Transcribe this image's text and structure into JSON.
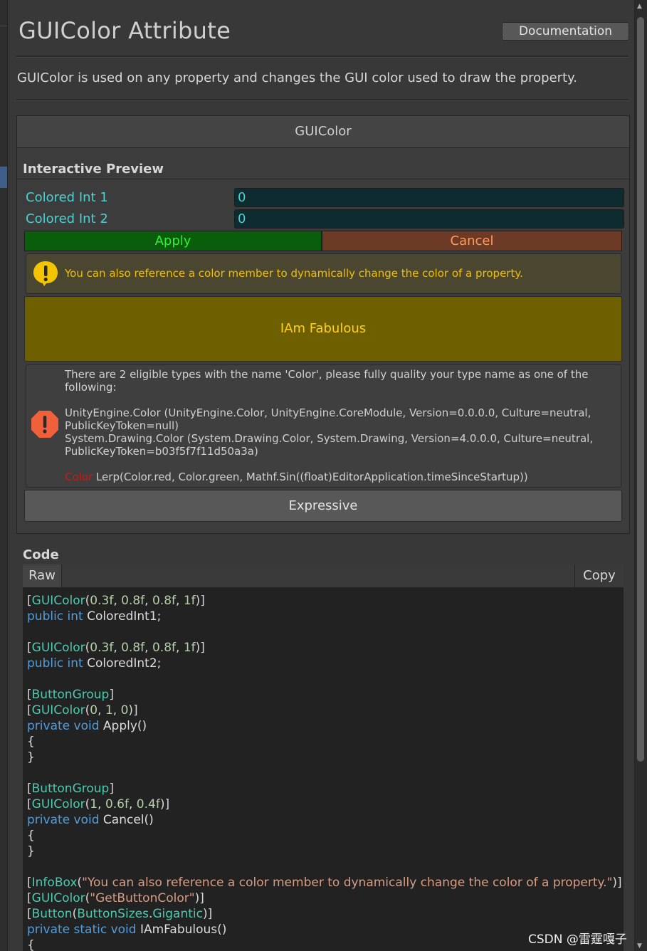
{
  "header": {
    "title": "GUIColor Attribute",
    "documentation_button": "Documentation",
    "description": "GUIColor is used on any property and changes the GUI color used to draw the property."
  },
  "panel": {
    "title": "GUIColor",
    "section_label": "Interactive Preview",
    "fields": [
      {
        "label": "Colored Int 1",
        "value": "0"
      },
      {
        "label": "Colored Int 2",
        "value": "0"
      }
    ],
    "apply_label": "Apply",
    "cancel_label": "Cancel",
    "info_text": "You can also reference a color member to dynamically change the color of a property.",
    "fabulous_label": "IAm Fabulous",
    "error": {
      "line1": "There are 2 eligible types with the name 'Color', please fully quality your type name as one of the following:",
      "line2": "UnityEngine.Color (UnityEngine.Color, UnityEngine.CoreModule, Version=0.0.0.0, Culture=neutral, PublicKeyToken=null)",
      "line3": "System.Drawing.Color (System.Drawing.Color, System.Drawing, Version=4.0.0.0, Culture=neutral, PublicKeyToken=b03f5f7f11d50a3a)",
      "expr_red": "Color",
      "expr_rest": "Lerp(Color.red, Color.green, Mathf.Sin((float)EditorApplication.timeSinceStartup))"
    },
    "expressive_label": "Expressive"
  },
  "code": {
    "label": "Code",
    "tab_raw": "Raw",
    "copy_label": "Copy"
  },
  "watermark": "CSDN @雷霆嘎子",
  "colors": {
    "apply_bg": "#0a5d0a",
    "cancel_bg": "#6d3b25",
    "fabulous_bg": "#6e5f00",
    "field_text": "#4dd0d0"
  }
}
